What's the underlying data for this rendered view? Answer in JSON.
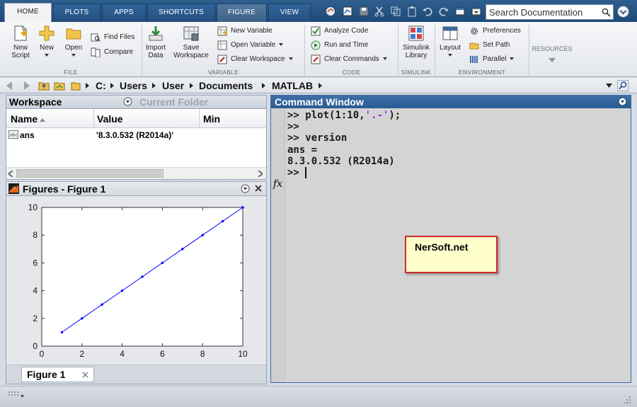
{
  "tabs": [
    {
      "label": "HOME"
    },
    {
      "label": "PLOTS"
    },
    {
      "label": "APPS"
    },
    {
      "label": "SHORTCUTS"
    },
    {
      "label": "FIGURE"
    },
    {
      "label": "VIEW"
    }
  ],
  "search": {
    "placeholder": "Search Documentation"
  },
  "ribbon": {
    "file": {
      "label": "FILE",
      "new_script": "New\nScript",
      "new": "New",
      "open": "Open",
      "find_files": "Find Files",
      "compare": "Compare"
    },
    "variable": {
      "label": "VARIABLE",
      "import_data": "Import\nData",
      "save_workspace": "Save\nWorkspace",
      "new_variable": "New Variable",
      "open_variable": "Open Variable",
      "clear_workspace": "Clear Workspace"
    },
    "code": {
      "label": "CODE",
      "analyze_code": "Analyze Code",
      "run_and_time": "Run and Time",
      "clear_commands": "Clear Commands"
    },
    "simulink": {
      "label": "SIMULINK",
      "simulink_library": "Simulink\nLibrary"
    },
    "environment": {
      "label": "ENVIRONMENT",
      "layout": "Layout",
      "preferences": "Preferences",
      "set_path": "Set Path",
      "parallel": "Parallel"
    },
    "resources": {
      "label": "RESOURCES"
    }
  },
  "address": {
    "crumbs": [
      "C:",
      "Users",
      "User",
      "Documents",
      "MATLAB"
    ]
  },
  "workspace": {
    "tab_active": "Workspace",
    "tab_inactive": "Current Folder",
    "columns": [
      "Name",
      "Value",
      "Min"
    ],
    "rows": [
      {
        "name": "ans",
        "value": "'8.3.0.532 (R2014a)'",
        "min": ""
      }
    ]
  },
  "figures": {
    "title": "Figures - Figure 1",
    "tab_label": "Figure 1"
  },
  "chart_data": {
    "type": "line",
    "title": "",
    "xlabel": "",
    "ylabel": "",
    "x": [
      1,
      2,
      3,
      4,
      5,
      6,
      7,
      8,
      9,
      10
    ],
    "series": [
      {
        "values": [
          1,
          2,
          3,
          4,
          5,
          6,
          7,
          8,
          9,
          10
        ],
        "color": "#0000ff",
        "line_style": "-.",
        "marker": "point"
      }
    ],
    "xlim": [
      0,
      10
    ],
    "ylim": [
      0,
      10
    ],
    "xticks": [
      0,
      2,
      4,
      6,
      8,
      10
    ],
    "yticks": [
      0,
      2,
      4,
      6,
      8,
      10
    ],
    "grid": false,
    "legend": "none"
  },
  "command_window": {
    "title": "Command Window",
    "lines": [
      {
        "prompt": ">> ",
        "code_before": "plot(1:10,",
        "string": "'.-'",
        "code_after": ");"
      },
      {
        "text": ">>"
      },
      {
        "text": ">> version"
      },
      {
        "text": "ans ="
      },
      {
        "text": "8.3.0.532 (R2014a)"
      }
    ],
    "current_prompt": ">> ",
    "fx_label": "fx"
  },
  "watermark": {
    "text": "NerSoft.net"
  },
  "colors": {
    "accent": "#2a5b93",
    "tab_bar": "#1d4a78",
    "plot_line": "#0000ff",
    "note_border": "#cc2b2b",
    "note_fill": "#ffffcc"
  }
}
